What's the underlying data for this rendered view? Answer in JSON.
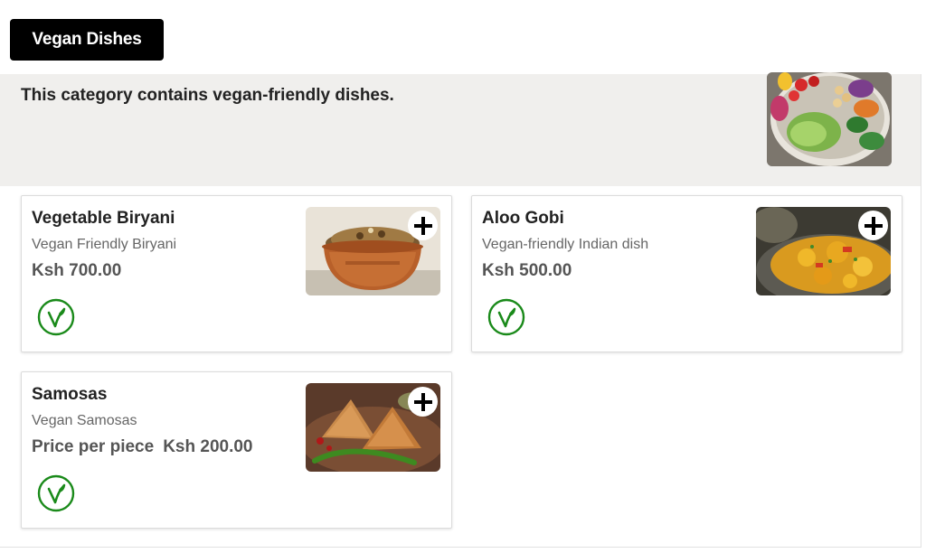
{
  "category": {
    "tab_label": "Vegan Dishes",
    "description": "This category contains vegan-friendly dishes.",
    "image_icon": "vegan-salad-bowl-photo"
  },
  "dishes": [
    {
      "name": "Vegetable Biryani",
      "subtitle": "Vegan Friendly Biryani",
      "price_prefix": "",
      "price": "Ksh 700.00",
      "image_icon": "biryani-copper-pot-photo",
      "badge_icon": "vegan-leaf-badge"
    },
    {
      "name": "Aloo Gobi",
      "subtitle": "Vegan-friendly Indian dish",
      "price_prefix": "",
      "price": "Ksh 500.00",
      "image_icon": "aloo-gobi-curry-photo",
      "badge_icon": "vegan-leaf-badge"
    },
    {
      "name": "Samosas",
      "subtitle": "Vegan Samosas",
      "price_prefix": "Price per piece",
      "price": "Ksh 200.00",
      "image_icon": "samosas-plate-photo",
      "badge_icon": "vegan-leaf-badge"
    }
  ],
  "colors": {
    "tab_bg": "#000000",
    "banner_bg": "#f0efed",
    "vegan_green": "#1a8a1a",
    "price_text": "#555555"
  }
}
